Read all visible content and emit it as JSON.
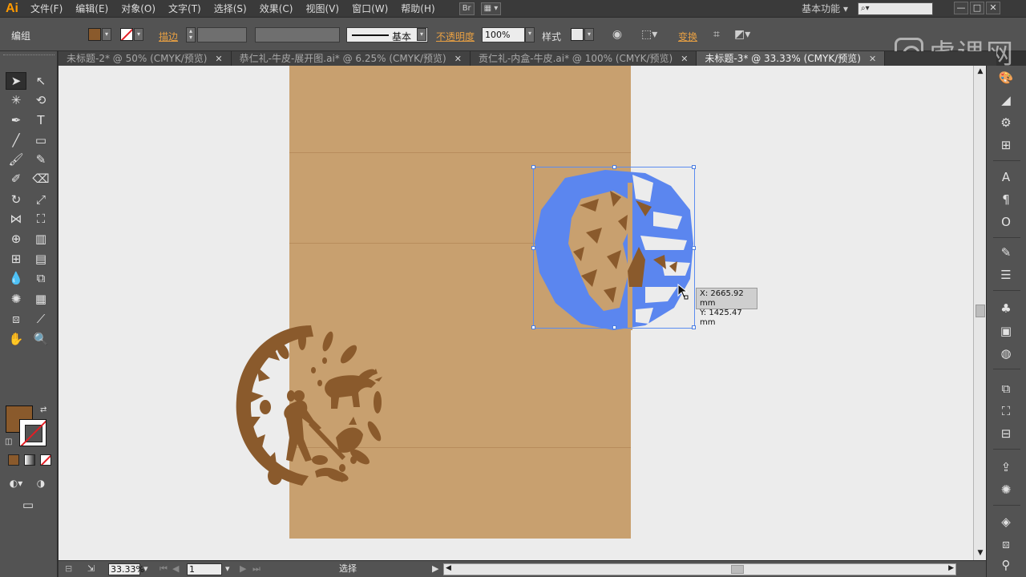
{
  "app": {
    "logo": "Ai"
  },
  "menu": {
    "items": [
      "文件(F)",
      "编辑(E)",
      "对象(O)",
      "文字(T)",
      "选择(S)",
      "效果(C)",
      "视图(V)",
      "窗口(W)",
      "帮助(H)"
    ],
    "bridge_label": "Br",
    "workspace": "基本功能",
    "window_controls": [
      "—",
      "□",
      "✕"
    ]
  },
  "control": {
    "selection_type": "编组",
    "fill_color": "#8a5a2c",
    "stroke_label": "描边",
    "stroke_profile_label": "基本",
    "opacity_label": "不透明度",
    "opacity_value": "100%",
    "style_label": "样式",
    "transform_label": "变换"
  },
  "watermark": {
    "text": "虎课网"
  },
  "tabs": [
    {
      "label": "未标题-2* @ 50% (CMYK/预览)",
      "close": "✕",
      "active": false
    },
    {
      "label": "恭仁礼-牛皮-展开图.ai* @ 6.25% (CMYK/预览)",
      "close": "✕",
      "active": false
    },
    {
      "label": "贡仁礼-内盒-牛皮.ai* @ 100% (CMYK/预览)",
      "close": "✕",
      "active": false
    },
    {
      "label": "未标题-3* @ 33.33% (CMYK/预览)",
      "close": "✕",
      "active": true
    }
  ],
  "canvas": {
    "artboard_color": "#c8a06f",
    "pasteboard_color": "#ececec",
    "artwork_color": "#8a5a2c",
    "selection_color": "#5b8cf0",
    "selected_fill": "#5b86ef"
  },
  "tooltip": {
    "x": "X: 2665.92 mm",
    "y": "Y: 1425.47 mm"
  },
  "status": {
    "zoom": "33.33%",
    "page": "1",
    "tool": "选择"
  }
}
